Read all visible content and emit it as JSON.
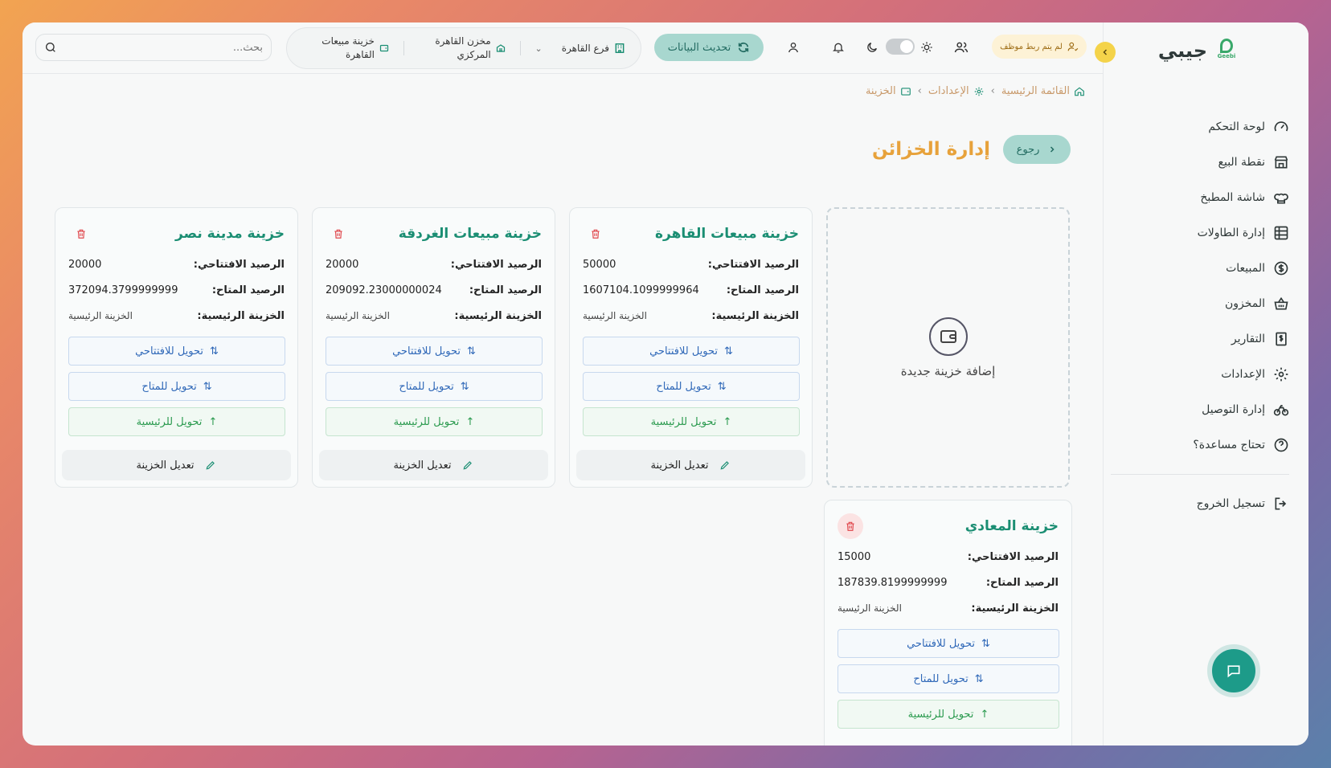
{
  "brand": {
    "name": "جيبي",
    "logo_text": "Geebi"
  },
  "sidebar": {
    "items": [
      {
        "label": "لوحة التحكم",
        "icon": "gauge-icon"
      },
      {
        "label": "نقطة البيع",
        "icon": "store-icon"
      },
      {
        "label": "شاشة المطبخ",
        "icon": "chef-hat-icon"
      },
      {
        "label": "إدارة الطاولات",
        "icon": "table-grid-icon"
      },
      {
        "label": "المبيعات",
        "icon": "dollar-circle-icon"
      },
      {
        "label": "المخزون",
        "icon": "basket-icon"
      },
      {
        "label": "التقارير",
        "icon": "receipt-dollar-icon"
      },
      {
        "label": "الإعدادات",
        "icon": "gear-icon"
      },
      {
        "label": "إدارة التوصيل",
        "icon": "bike-icon"
      },
      {
        "label": "تحتاج مساعدة؟",
        "icon": "help-circle-icon"
      }
    ],
    "logout_label": "تسجيل الخروج"
  },
  "topbar": {
    "search_placeholder": "بحث...",
    "branch": "فرع القاهرة",
    "warehouse": "مخزن القاهرة المركزي",
    "treasury": "خزينة مبيعات القاهرة",
    "refresh_label": "تحديث البيانات",
    "staff_badge": "لم يتم ربط موظف"
  },
  "breadcrumb": {
    "home": "القائمة الرئيسية",
    "settings": "الإعدادات",
    "current": "الخزينة"
  },
  "page": {
    "back_label": "رجوع",
    "title": "إدارة الخزائن",
    "add_label": "إضافة خزينة جديدة"
  },
  "labels": {
    "opening": "الرصيد الافتتاحي:",
    "available": "الرصيد المتاح:",
    "main": "الخزينة الرئيسية:",
    "to_opening": "تحويل للافتتاحي",
    "to_available": "تحويل للمتاح",
    "to_main": "تحويل للرئيسية",
    "edit": "تعديل الخزينة"
  },
  "treasuries": [
    {
      "title": "خزينة مبيعات القاهرة",
      "opening": "50000",
      "available": "1607104.1099999964",
      "main": "الخزينة الرئيسية"
    },
    {
      "title": "خزينة مبيعات الغردقة",
      "opening": "20000",
      "available": "209092.23000000024",
      "main": "الخزينة الرئيسية"
    },
    {
      "title": "خزينة مدينة نصر",
      "opening": "20000",
      "available": "372094.3799999999",
      "main": "الخزينة الرئيسية"
    },
    {
      "title": "خزينة المعادي",
      "opening": "15000",
      "available": "187839.8199999999",
      "main": "الخزينة الرئيسية"
    }
  ],
  "colors": {
    "accent": "#1b8e73",
    "title": "#e7a23b",
    "blue_action": "#2f68b8",
    "green_action": "#2a9a4e",
    "danger": "#e0474c"
  }
}
